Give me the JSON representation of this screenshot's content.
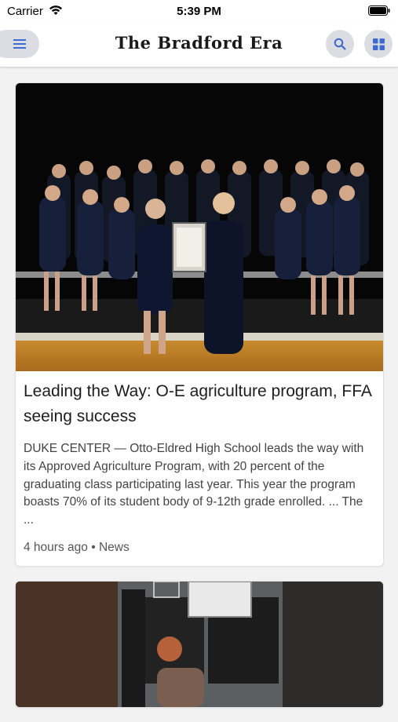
{
  "status_bar": {
    "carrier": "Carrier",
    "time": "5:39 PM"
  },
  "app_bar": {
    "logo_text": "The Bradford Era",
    "icons": [
      "menu-icon",
      "search-icon",
      "grid-icon"
    ],
    "accent_color": "#3f6bd1"
  },
  "articles": [
    {
      "headline": "Leading the Way: O-E agriculture program, FFA seeing success",
      "summary": "DUKE CENTER — Otto-Eldred High School leads the way with its Approved Agriculture Program, with 20 percent of the graduating class participating last year. This year the program boasts 70% of its student body of 9-12th grade enrolled. ... The ...",
      "time": "4 hours ago",
      "separator": "•",
      "category": "News"
    }
  ]
}
